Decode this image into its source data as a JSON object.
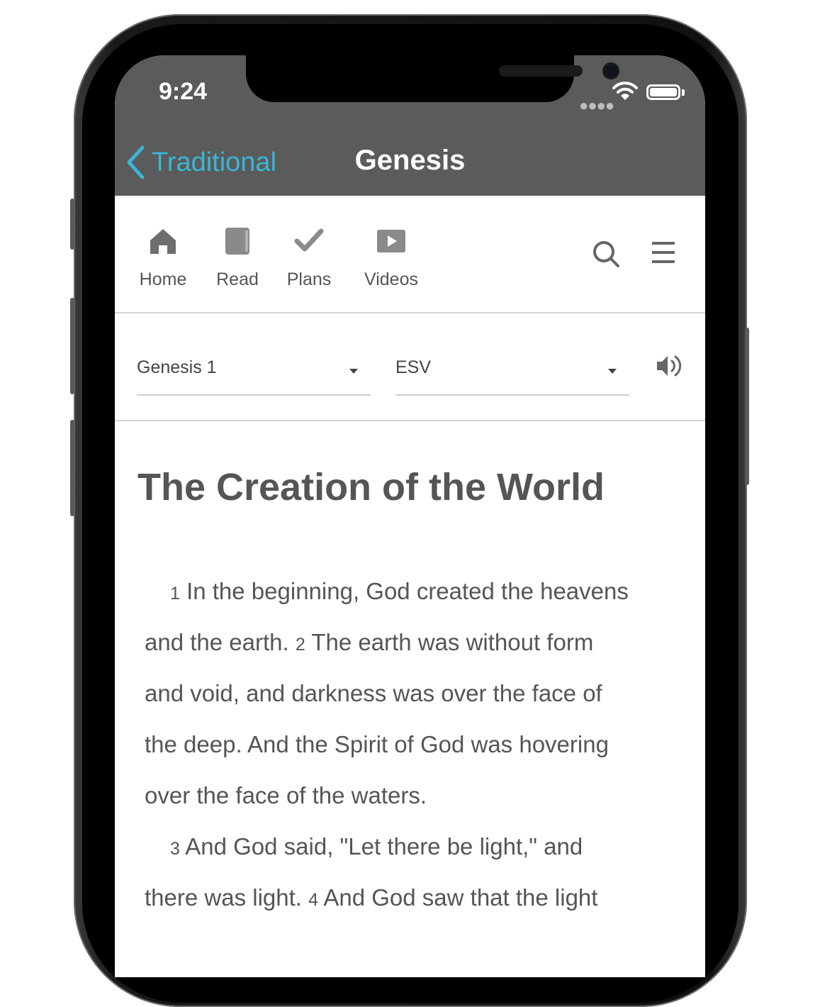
{
  "status_bar": {
    "time": "9:24"
  },
  "nav_bar": {
    "back_label": "Traditional",
    "title": "Genesis"
  },
  "toolbar": {
    "items": [
      {
        "label": "Home",
        "icon": "home-icon"
      },
      {
        "label": "Read",
        "icon": "book-icon"
      },
      {
        "label": "Plans",
        "icon": "checkmark-icon"
      },
      {
        "label": "Videos",
        "icon": "play-icon"
      }
    ],
    "search_icon": "search-icon",
    "menu_icon": "hamburger-menu-icon"
  },
  "selectors": {
    "chapter": "Genesis 1",
    "version": "ESV",
    "audio_icon": "speaker-icon"
  },
  "passage": {
    "heading": "The Creation of the World",
    "lines": [
      {
        "num": "1",
        "text": " In the beginning, God created the heavens"
      },
      {
        "pre": "and the earth. ",
        "num": "2",
        "text": " The earth was without form"
      },
      {
        "text": "and void, and darkness was over the face of"
      },
      {
        "text": "the deep. And the Spirit of God was hovering"
      },
      {
        "text": "over the face of the waters."
      },
      {
        "num": "3",
        "text": " And God said, \"Let there be light,\" and"
      },
      {
        "pre": "there was light. ",
        "num": "4",
        "text": " And God saw that the light"
      }
    ]
  },
  "colors": {
    "nav_background": "#5b5b5b",
    "accent": "#3ab6d6",
    "text": "#555555"
  }
}
